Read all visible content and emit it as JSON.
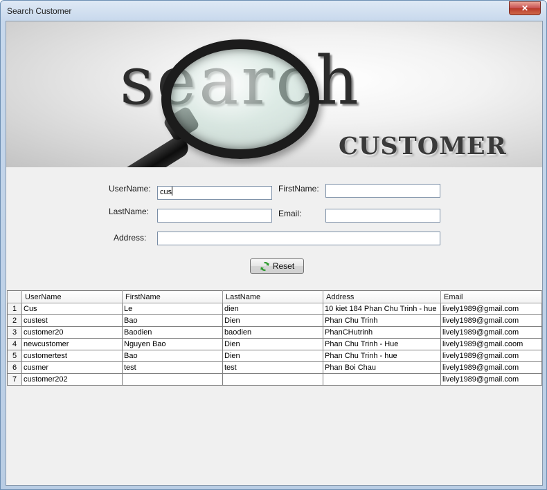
{
  "window": {
    "title": "Search Customer",
    "close_glyph": "✕"
  },
  "banner": {
    "word": "search",
    "subtitle": "CUSTOMER"
  },
  "form": {
    "username_label": "UserName:",
    "username_value": "cus",
    "firstname_label": "FirstName:",
    "firstname_value": "",
    "lastname_label": "LastName:",
    "lastname_value": "",
    "email_label": "Email:",
    "email_value": "",
    "address_label": "Address:",
    "address_value": "",
    "reset_label": "Reset",
    "reset_icon": "refresh-icon"
  },
  "table": {
    "columns": [
      "UserName",
      "FirstName",
      "LastName",
      "Address",
      "Email"
    ],
    "rows": [
      {
        "num": "1",
        "username": "Cus",
        "firstname": "Le",
        "lastname": "dien",
        "address": "10 kiet 184 Phan Chu Trinh - hue",
        "email": "lively1989@gmail.com"
      },
      {
        "num": "2",
        "username": "custest",
        "firstname": "Bao",
        "lastname": "Dien",
        "address": "Phan Chu Trinh",
        "email": "lively1989@gmail.com"
      },
      {
        "num": "3",
        "username": "customer20",
        "firstname": "Baodien",
        "lastname": "baodien",
        "address": "PhanCHutrinh",
        "email": "lively1989@gmail.com"
      },
      {
        "num": "4",
        "username": "newcustomer",
        "firstname": "Nguyen Bao",
        "lastname": "Dien",
        "address": "Phan Chu Trinh - Hue",
        "email": "lively1989@gmail.coom"
      },
      {
        "num": "5",
        "username": "customertest",
        "firstname": "Bao",
        "lastname": "Dien",
        "address": "Phan Chu Trinh - hue",
        "email": "lively1989@gmail.com"
      },
      {
        "num": "6",
        "username": "cusmer",
        "firstname": "test",
        "lastname": "test",
        "address": "Phan Boi Chau",
        "email": "lively1989@gmail.com"
      },
      {
        "num": "7",
        "username": "customer202",
        "firstname": "",
        "lastname": "",
        "address": "",
        "email": "lively1989@gmail.com"
      }
    ]
  }
}
